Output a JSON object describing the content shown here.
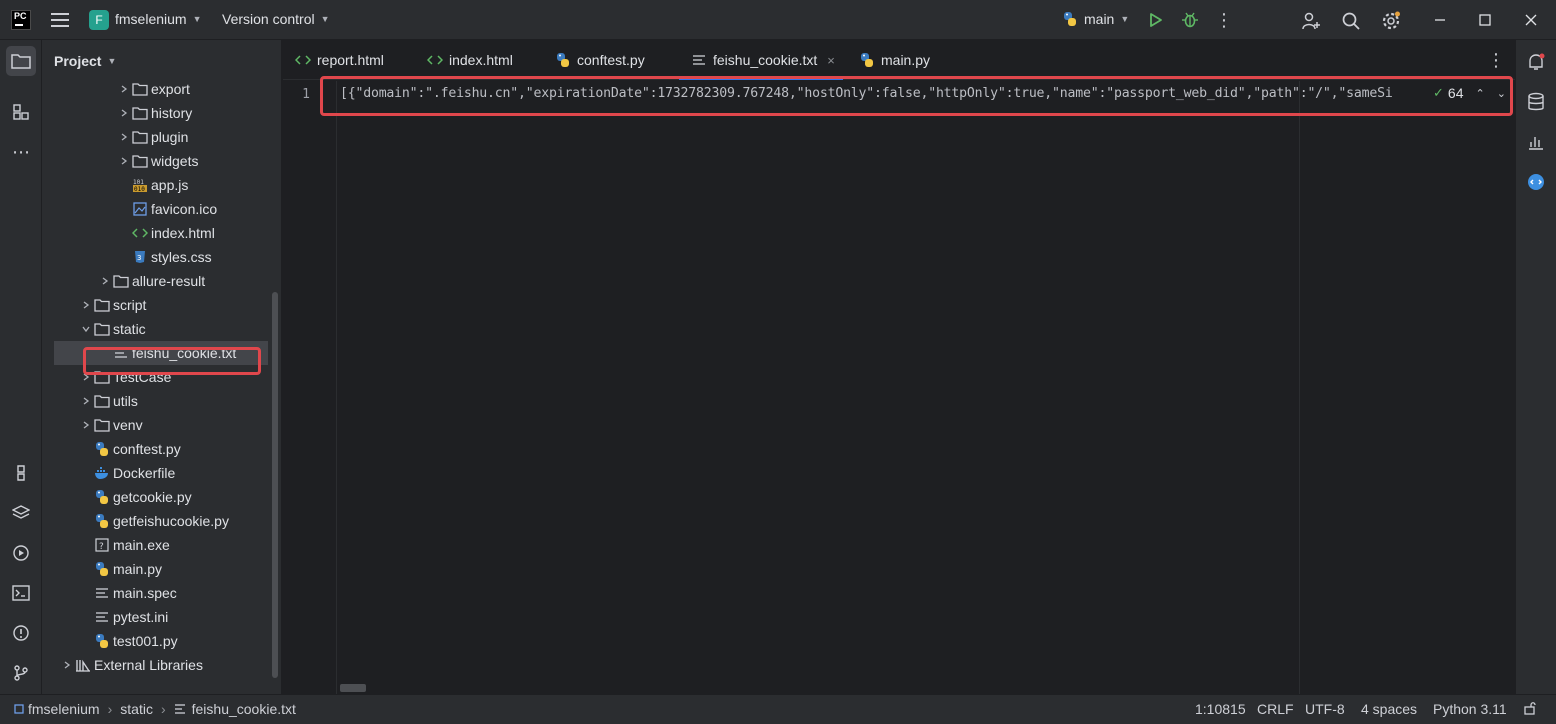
{
  "titlebar": {
    "logo_text": "PC",
    "project_badge": "F",
    "project_name": "fmselenium",
    "vcs_label": "Version control",
    "branch": "main"
  },
  "project_panel": {
    "title": "Project",
    "tree": [
      {
        "label": "export",
        "type": "folder",
        "expanded": false,
        "depth": 3
      },
      {
        "label": "history",
        "type": "folder",
        "expanded": false,
        "depth": 3
      },
      {
        "label": "plugin",
        "type": "folder",
        "expanded": false,
        "depth": 3
      },
      {
        "label": "widgets",
        "type": "folder",
        "expanded": false,
        "depth": 3
      },
      {
        "label": "app.js",
        "type": "js",
        "depth": 3
      },
      {
        "label": "favicon.ico",
        "type": "image",
        "depth": 3
      },
      {
        "label": "index.html",
        "type": "html",
        "depth": 3
      },
      {
        "label": "styles.css",
        "type": "css",
        "depth": 3
      },
      {
        "label": "allure-result",
        "type": "folder",
        "expanded": false,
        "depth": 2
      },
      {
        "label": "script",
        "type": "folder",
        "expanded": false,
        "depth": 1
      },
      {
        "label": "static",
        "type": "folder",
        "expanded": true,
        "depth": 1
      },
      {
        "label": "feishu_cookie.txt",
        "type": "text",
        "depth": 2,
        "selected": true
      },
      {
        "label": "TestCase",
        "type": "folder",
        "expanded": false,
        "depth": 1
      },
      {
        "label": "utils",
        "type": "folder",
        "expanded": false,
        "depth": 1
      },
      {
        "label": "venv",
        "type": "folder",
        "expanded": false,
        "depth": 1
      },
      {
        "label": "conftest.py",
        "type": "python",
        "depth": 1
      },
      {
        "label": "Dockerfile",
        "type": "docker",
        "depth": 1
      },
      {
        "label": "getcookie.py",
        "type": "python",
        "depth": 1
      },
      {
        "label": "getfeishucookie.py",
        "type": "python",
        "depth": 1
      },
      {
        "label": "main.exe",
        "type": "unknown",
        "depth": 1
      },
      {
        "label": "main.py",
        "type": "python",
        "depth": 1
      },
      {
        "label": "main.spec",
        "type": "text",
        "depth": 1
      },
      {
        "label": "pytest.ini",
        "type": "text",
        "depth": 1
      },
      {
        "label": "test001.py",
        "type": "python",
        "depth": 1
      },
      {
        "label": "External Libraries",
        "type": "library",
        "expanded": false,
        "depth": 0
      }
    ]
  },
  "editor": {
    "tabs": [
      {
        "label": "report.html",
        "icon": "html-icon"
      },
      {
        "label": "index.html",
        "icon": "html-icon"
      },
      {
        "label": "conftest.py",
        "icon": "python-icon"
      },
      {
        "label": "feishu_cookie.txt",
        "icon": "text-file-icon",
        "active": true,
        "close": "×"
      },
      {
        "label": "main.py",
        "icon": "python-icon"
      }
    ],
    "line_number": "1",
    "code_line": "[{\"domain\":\".feishu.cn\",\"expirationDate\":1732782309.767248,\"hostOnly\":false,\"httpOnly\":true,\"name\":\"passport_web_did\",\"path\":\"/\",\"sameSi",
    "inspection_count": "64"
  },
  "statusbar": {
    "breadcrumb": [
      "fmselenium",
      "static",
      "feishu_cookie.txt"
    ],
    "position": "1:10815",
    "line_separator": "CRLF",
    "encoding": "UTF-8",
    "indent": "4 spaces",
    "interpreter": "Python 3.11"
  },
  "colors": {
    "accent": "#3574f0",
    "highlight_box": "#e0474c",
    "run_green": "#5fb865"
  }
}
